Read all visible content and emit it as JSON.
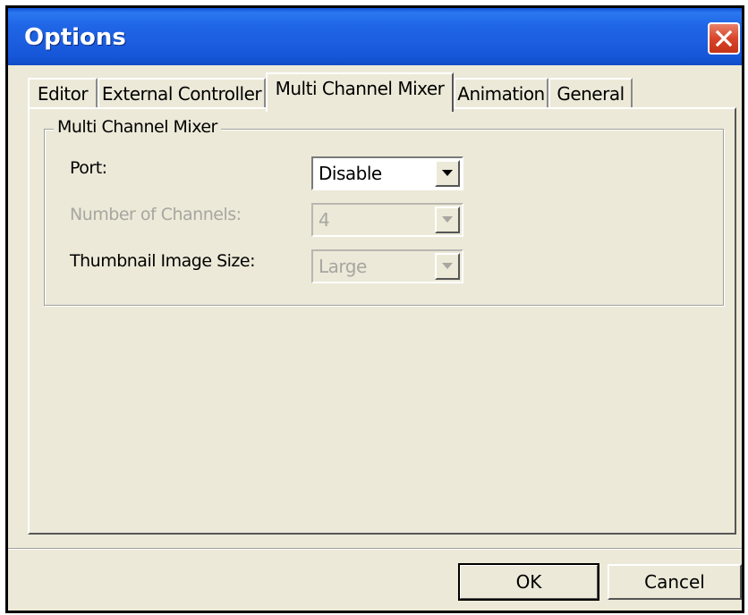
{
  "window": {
    "title": "Options"
  },
  "tabs": [
    {
      "label": "Editor"
    },
    {
      "label": "External Controller"
    },
    {
      "label": "Multi Channel Mixer",
      "active": true
    },
    {
      "label": "Animation"
    },
    {
      "label": "General"
    }
  ],
  "group": {
    "title": "Multi Channel Mixer",
    "fields": [
      {
        "label": "Port:",
        "value": "Disable",
        "enabled": true
      },
      {
        "label": "Number of Channels:",
        "value": "4",
        "enabled": false
      },
      {
        "label": "Thumbnail Image Size:",
        "value": "Large",
        "enabled": false
      }
    ]
  },
  "buttons": {
    "ok": "OK",
    "cancel": "Cancel"
  },
  "icons": {
    "close": "close-icon",
    "dropdown": "chevron-down-icon"
  },
  "colors": {
    "titlebar": "#1f66e6",
    "close_button": "#d9452a",
    "dialog_bg": "#ece9d8",
    "disabled_text": "#a7a6a0"
  }
}
